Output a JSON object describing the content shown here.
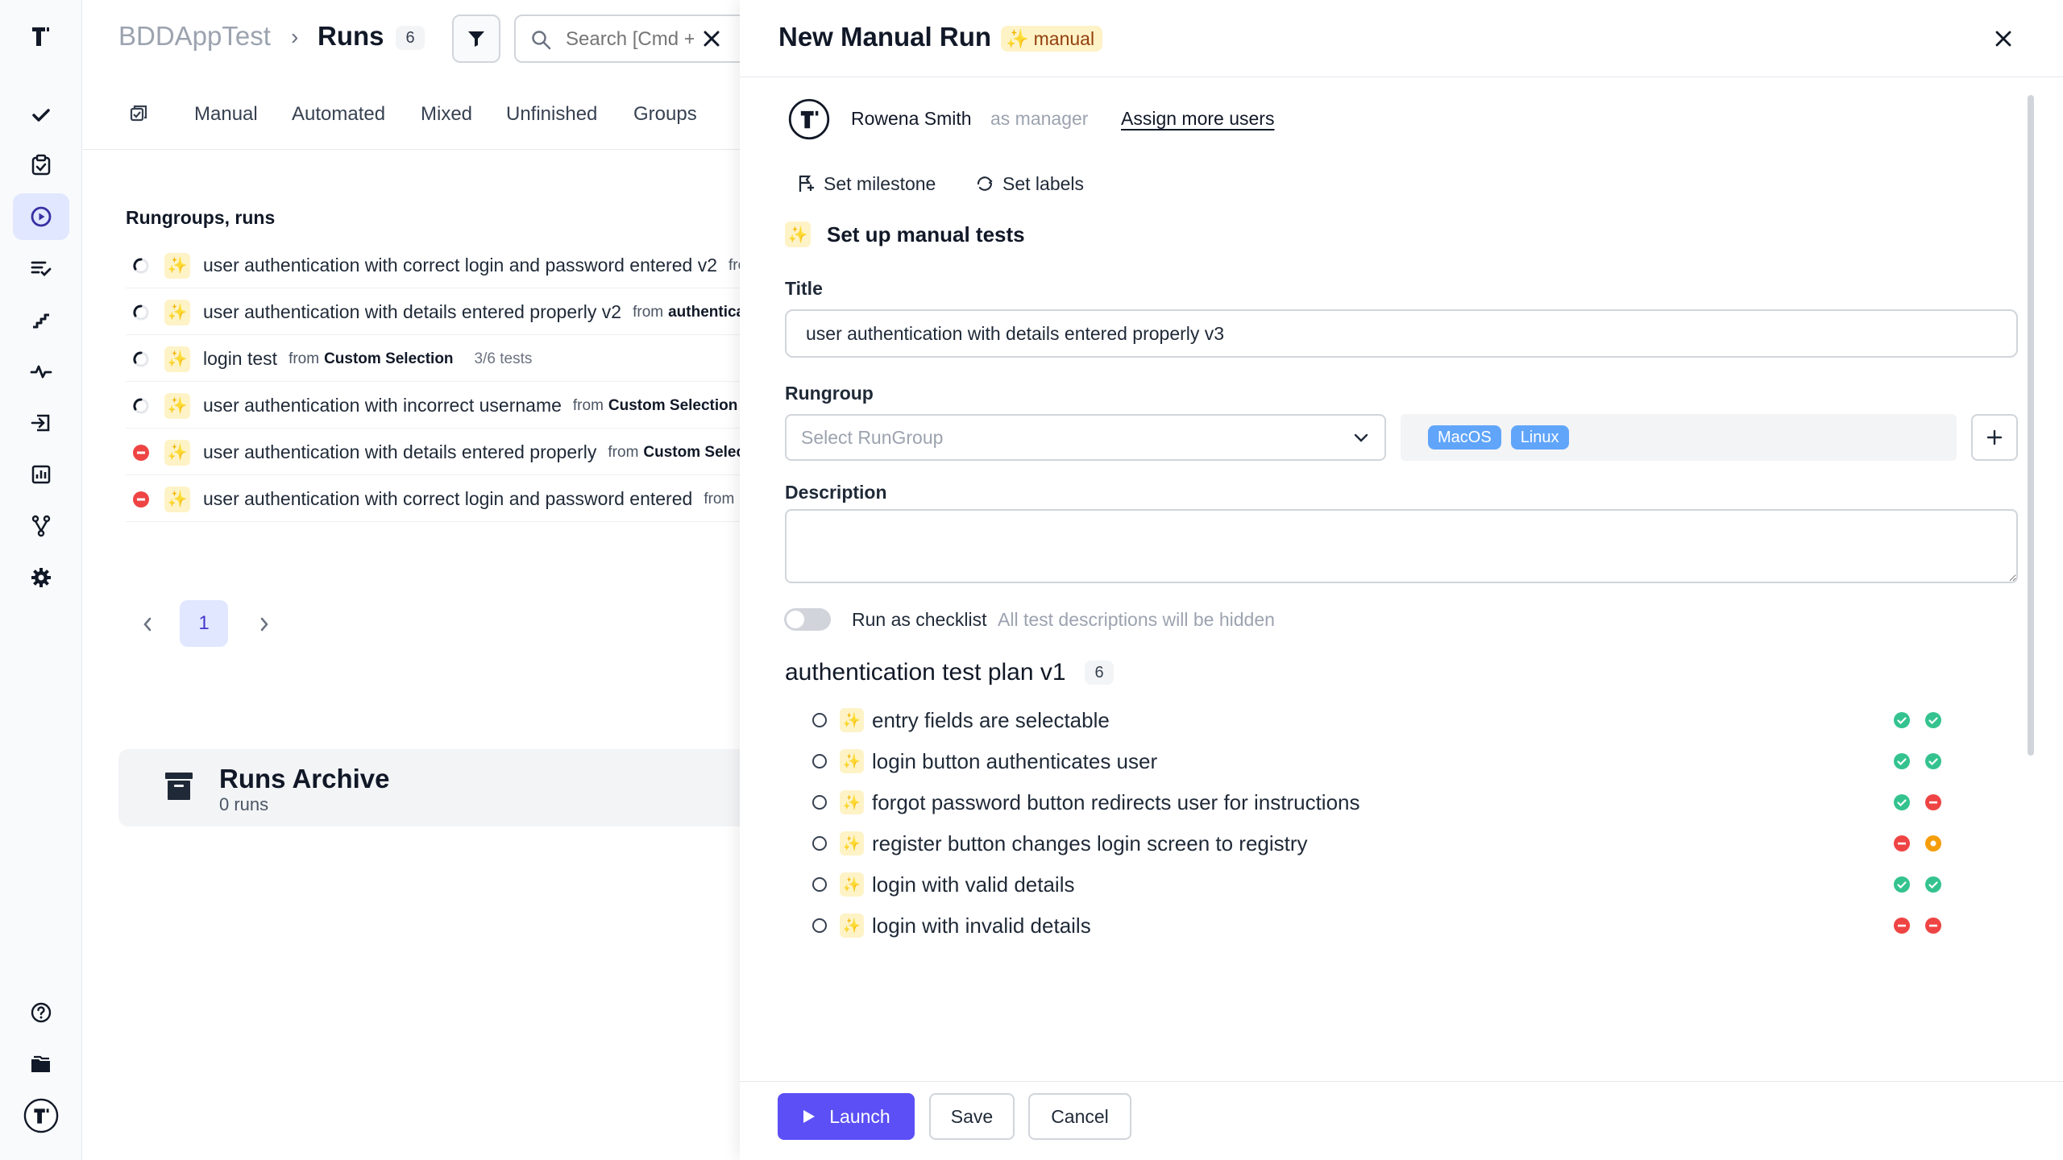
{
  "sidebar": {
    "items": [
      {
        "icon": "app-logo-icon"
      },
      {
        "icon": "check-icon"
      },
      {
        "icon": "clipboard-check-icon"
      },
      {
        "icon": "play-circle-icon",
        "active": true
      },
      {
        "icon": "list-check-icon"
      },
      {
        "icon": "steps-icon"
      },
      {
        "icon": "pulse-icon"
      },
      {
        "icon": "import-icon"
      },
      {
        "icon": "bar-chart-icon"
      },
      {
        "icon": "branch-icon"
      },
      {
        "icon": "gear-icon"
      },
      {
        "icon": "help-icon"
      },
      {
        "icon": "folders-icon"
      },
      {
        "icon": "user-avatar-icon"
      }
    ]
  },
  "header": {
    "project": "BDDAppTest",
    "separator": "›",
    "section": "Runs",
    "runs_count": "6",
    "search_placeholder": "Search [Cmd + K]"
  },
  "tabs": [
    "Manual",
    "Automated",
    "Mixed",
    "Unfinished",
    "Groups"
  ],
  "runs_list": {
    "title": "Rungroups, runs",
    "rows": [
      {
        "status": "in-progress",
        "title": "user authentication with correct login and password entered v2",
        "from": "from",
        "source": "",
        "tests": ""
      },
      {
        "status": "in-progress",
        "title": "user authentication with details entered properly v2",
        "from": "from",
        "source": "authentication",
        "tests": ""
      },
      {
        "status": "in-progress",
        "title": "login test",
        "from": "from",
        "source": "Custom Selection",
        "tests": "3/6 tests"
      },
      {
        "status": "in-progress",
        "title": "user authentication with incorrect username",
        "from": "from",
        "source": "Custom Selection",
        "tests": ""
      },
      {
        "status": "failed",
        "title": "user authentication with details entered properly",
        "from": "from",
        "source": "Custom Selection",
        "tests": ""
      },
      {
        "status": "failed",
        "title": "user authentication with correct login and password entered",
        "from": "from",
        "source": "",
        "tests": ""
      }
    ]
  },
  "pagination": {
    "current": "1"
  },
  "archive": {
    "title": "Runs Archive",
    "subtitle": "0 runs"
  },
  "panel": {
    "title": "New Manual Run",
    "badge": "manual",
    "user_name": "Rowena Smith",
    "user_role": "as manager",
    "assign_link": "Assign more users",
    "set_milestone": "Set milestone",
    "set_labels": "Set labels",
    "setup_title": "Set up manual tests",
    "title_label": "Title",
    "title_value": "user authentication with details entered properly v3",
    "rungroup_label": "Rungroup",
    "rungroup_placeholder": "Select RunGroup",
    "env_tags": [
      "MacOS",
      "Linux"
    ],
    "description_label": "Description",
    "checklist_label": "Run as checklist",
    "checklist_hint": "All test descriptions will be hidden",
    "plan_title": "authentication test plan v1",
    "plan_count": "6",
    "tests": [
      {
        "title": "entry fields are selectable",
        "status": [
          "passed",
          "passed"
        ]
      },
      {
        "title": "login button authenticates user",
        "status": [
          "passed",
          "passed"
        ]
      },
      {
        "title": "forgot password button redirects user for instructions",
        "status": [
          "passed",
          "failed"
        ]
      },
      {
        "title": "register button changes login screen to registry",
        "status": [
          "failed",
          "skipped"
        ]
      },
      {
        "title": "login with valid details",
        "status": [
          "passed",
          "passed"
        ]
      },
      {
        "title": "login with invalid details",
        "status": [
          "failed",
          "failed"
        ]
      }
    ],
    "launch": "Launch",
    "save": "Save",
    "cancel": "Cancel"
  },
  "colors": {
    "accent": "#5b4ff5",
    "passed": "#34c38f",
    "failed": "#ef4444",
    "skipped": "#f59e0b",
    "emoji_bg": "#fef3c7",
    "tag": "#60a5fa"
  }
}
